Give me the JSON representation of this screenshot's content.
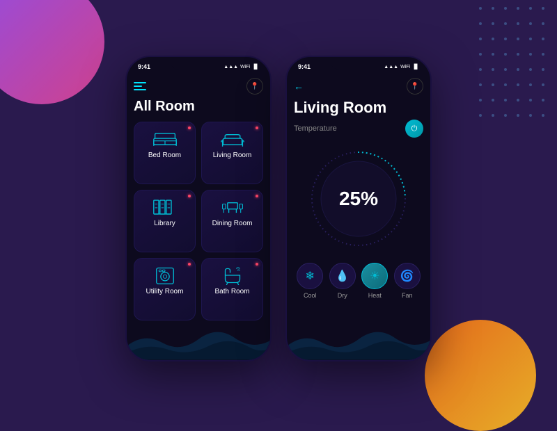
{
  "background": {
    "colors": {
      "main": "#2a1a4e",
      "purple_circle": "#a855f7",
      "orange_circle": "#f97316"
    }
  },
  "phone1": {
    "status_time": "9:41",
    "title": "All Room",
    "rooms": [
      {
        "label": "Bed Room",
        "icon": "bed"
      },
      {
        "label": "Living Room",
        "icon": "sofa"
      },
      {
        "label": "Library",
        "icon": "bookshelf"
      },
      {
        "label": "Dining Room",
        "icon": "dining"
      },
      {
        "label": "Utility Room",
        "icon": "washer"
      },
      {
        "label": "Bath Room",
        "icon": "bath"
      }
    ]
  },
  "phone2": {
    "status_time": "9:41",
    "title": "Living Room",
    "temperature_label": "Temperature",
    "percent": "25%",
    "controls": [
      {
        "label": "Cool",
        "icon": "❄",
        "active": false
      },
      {
        "label": "Dry",
        "icon": "💧",
        "active": false
      },
      {
        "label": "Heat",
        "icon": "☀",
        "active": true
      },
      {
        "label": "Fan",
        "icon": "🌀",
        "active": false
      }
    ]
  }
}
